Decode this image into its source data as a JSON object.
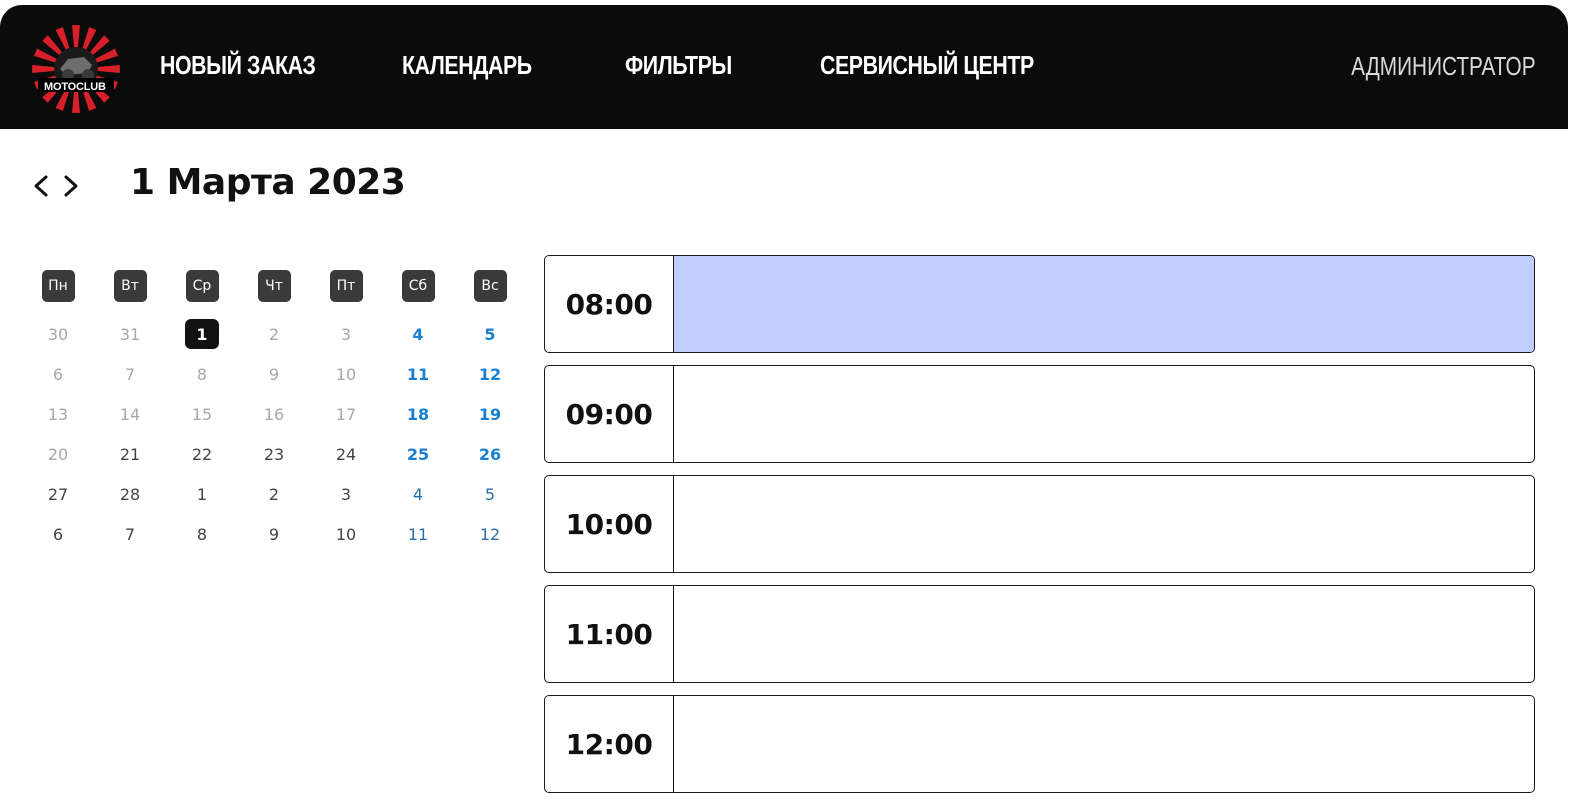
{
  "header": {
    "logo_text": "MOTOCLUB",
    "nav": [
      {
        "label": "НОВЫЙ ЗАКАЗ"
      },
      {
        "label": "КАЛЕНДАРЬ"
      },
      {
        "label": "ФИЛЬТРЫ"
      },
      {
        "label": "СЕРВИСНЫЙ ЦЕНТР"
      }
    ],
    "user_role": "АДМИНИСТРАТОР"
  },
  "date_nav": {
    "prev_icon": "chevron-left-icon",
    "next_icon": "chevron-right-icon",
    "title": "1 Марта 2023"
  },
  "calendar": {
    "weekdays": [
      "Пн",
      "Вт",
      "Ср",
      "Чт",
      "Пт",
      "Сб",
      "Вс"
    ],
    "weeks": [
      [
        {
          "d": "30",
          "s": "muted"
        },
        {
          "d": "31",
          "s": "muted"
        },
        {
          "d": "1",
          "s": "selected"
        },
        {
          "d": "2",
          "s": "muted"
        },
        {
          "d": "3",
          "s": "muted"
        },
        {
          "d": "4",
          "s": "weekend"
        },
        {
          "d": "5",
          "s": "weekend"
        }
      ],
      [
        {
          "d": "6",
          "s": "muted"
        },
        {
          "d": "7",
          "s": "muted"
        },
        {
          "d": "8",
          "s": "muted"
        },
        {
          "d": "9",
          "s": "muted"
        },
        {
          "d": "10",
          "s": "muted"
        },
        {
          "d": "11",
          "s": "weekend"
        },
        {
          "d": "12",
          "s": "weekend"
        }
      ],
      [
        {
          "d": "13",
          "s": "muted"
        },
        {
          "d": "14",
          "s": "muted"
        },
        {
          "d": "15",
          "s": "muted"
        },
        {
          "d": "16",
          "s": "muted"
        },
        {
          "d": "17",
          "s": "muted"
        },
        {
          "d": "18",
          "s": "weekend"
        },
        {
          "d": "19",
          "s": "weekend"
        }
      ],
      [
        {
          "d": "20",
          "s": "muted"
        },
        {
          "d": "21",
          "s": "normal"
        },
        {
          "d": "22",
          "s": "normal"
        },
        {
          "d": "23",
          "s": "normal"
        },
        {
          "d": "24",
          "s": "normal"
        },
        {
          "d": "25",
          "s": "weekend"
        },
        {
          "d": "26",
          "s": "weekend"
        }
      ],
      [
        {
          "d": "27",
          "s": "normal"
        },
        {
          "d": "28",
          "s": "normal"
        },
        {
          "d": "1",
          "s": "normal"
        },
        {
          "d": "2",
          "s": "normal"
        },
        {
          "d": "3",
          "s": "normal"
        },
        {
          "d": "4",
          "s": "weekend-dim"
        },
        {
          "d": "5",
          "s": "weekend-dim"
        }
      ],
      [
        {
          "d": "6",
          "s": "normal"
        },
        {
          "d": "7",
          "s": "normal"
        },
        {
          "d": "8",
          "s": "normal"
        },
        {
          "d": "9",
          "s": "normal"
        },
        {
          "d": "10",
          "s": "normal"
        },
        {
          "d": "11",
          "s": "weekend-dim"
        },
        {
          "d": "12",
          "s": "weekend-dim"
        }
      ]
    ]
  },
  "schedule": {
    "slots": [
      {
        "time": "08:00",
        "booked": true
      },
      {
        "time": "09:00",
        "booked": false
      },
      {
        "time": "10:00",
        "booked": false
      },
      {
        "time": "11:00",
        "booked": false
      },
      {
        "time": "12:00",
        "booked": false
      }
    ]
  },
  "colors": {
    "header_bg": "#0b0b0b",
    "logo_red": "#d8202a",
    "booked_slot": "#c0cdff",
    "weekend": "#1a7fd1"
  }
}
